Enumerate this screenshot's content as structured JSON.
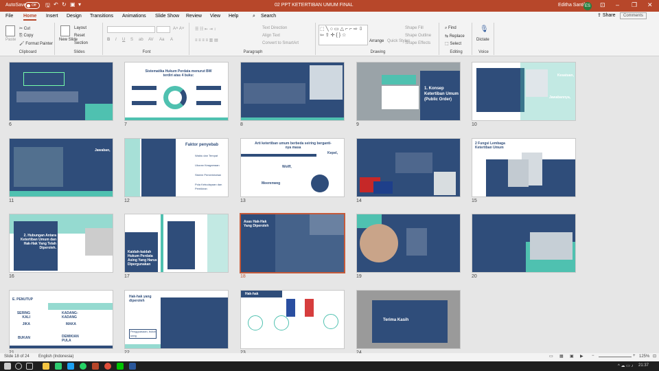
{
  "app": {
    "autosave_label": "AutoSave",
    "autosave_state": "Off",
    "document_title": "02 PPT KETERTIBAN UMUM FINAL",
    "user_name": "Editha Santika",
    "user_initials": "ES"
  },
  "tabs": [
    "File",
    "Home",
    "Insert",
    "Design",
    "Transitions",
    "Animations",
    "Slide Show",
    "Review",
    "View",
    "Help"
  ],
  "search": {
    "label": "Search"
  },
  "share_label": "Share",
  "comments_label": "Comments",
  "ribbon": {
    "clipboard": {
      "label": "Clipboard",
      "paste": "Paste",
      "cut": "Cut",
      "copy": "Copy",
      "format_painter": "Format Painter"
    },
    "slides": {
      "label": "Slides",
      "new_slide": "New Slide",
      "layout": "Layout",
      "reset": "Reset",
      "section": "Section"
    },
    "font": {
      "label": "Font"
    },
    "paragraph": {
      "label": "Paragraph",
      "text_direction": "Text Direction",
      "align_text": "Align Text",
      "convert_smartart": "Convert to SmartArt"
    },
    "drawing": {
      "label": "Drawing",
      "arrange": "Arrange",
      "quick_styles": "Quick Styles",
      "shape_fill": "Shape Fill",
      "shape_outline": "Shape Outline",
      "shape_effects": "Shape Effects"
    },
    "editing": {
      "label": "Editing",
      "find": "Find",
      "replace": "Replace",
      "select": "Select"
    },
    "voice": {
      "label": "Voice",
      "dictate": "Dictate"
    }
  },
  "slides": [
    {
      "num": "6"
    },
    {
      "num": "7",
      "title": "Sistematika Hukum Perdata menurut BW terdiri atas 4 buku:"
    },
    {
      "num": "8"
    },
    {
      "num": "9",
      "title": "1. Konsep Ketertiban Umum (Public Order)"
    },
    {
      "num": "10",
      "labels": [
        "Kesatuan,",
        "Jawabannya,"
      ]
    },
    {
      "num": "11",
      "labels": [
        "Jawaban,"
      ]
    },
    {
      "num": "12",
      "title": "Faktor penyebab",
      "items": [
        "Waktu dan Tempat",
        "Ukuran Keagamaan",
        "Sistem Pemerintahan",
        "Pola Kebudayaan",
        "Pola Kebudayaan dan Pemikiran"
      ]
    },
    {
      "num": "13",
      "title": "Arti ketertiban umum berbeda seiring berganti-nya masa",
      "labels": [
        "Kepel,",
        "Wolff,",
        "Meerenweg"
      ]
    },
    {
      "num": "14"
    },
    {
      "num": "15",
      "title": "2 Fungsi Lembaga Ketertiban Umum"
    },
    {
      "num": "16",
      "title": "2. Hubungan Antara Ketertiban Umum dan Hak-Hak Yang Telah Diperoleh."
    },
    {
      "num": "17",
      "title": "Kaidah-kaidah Hukum Perdata Asing Yang Harus Dipergunakan"
    },
    {
      "num": "18",
      "title": "Asas Hak-Hak Yang Diperoleh"
    },
    {
      "num": "19"
    },
    {
      "num": "20"
    },
    {
      "num": "21",
      "title": "E. PENUTUP",
      "words": [
        "SERING KALI",
        "JIKA",
        "BUKAN",
        "KADANG-KADANG",
        "MAKA",
        "DEMIKIAN PULA"
      ]
    },
    {
      "num": "22",
      "title": "Hak-hak yang diperoleh",
      "labels": [
        "Pengguasaan, bukan uang"
      ]
    },
    {
      "num": "23",
      "title": "Hak-hak"
    },
    {
      "num": "24",
      "title": "Terima Kasih"
    }
  ],
  "status": {
    "slide_info": "Slide 18 of 24",
    "language": "English (Indonesia)",
    "zoom": "125%"
  },
  "taskbar": {
    "time": "21:37"
  },
  "colors": {
    "accent": "#b7472a",
    "slide_blue": "#2f4d7a",
    "slide_teal": "#4fc1b0",
    "selection": "#c55a3a"
  }
}
